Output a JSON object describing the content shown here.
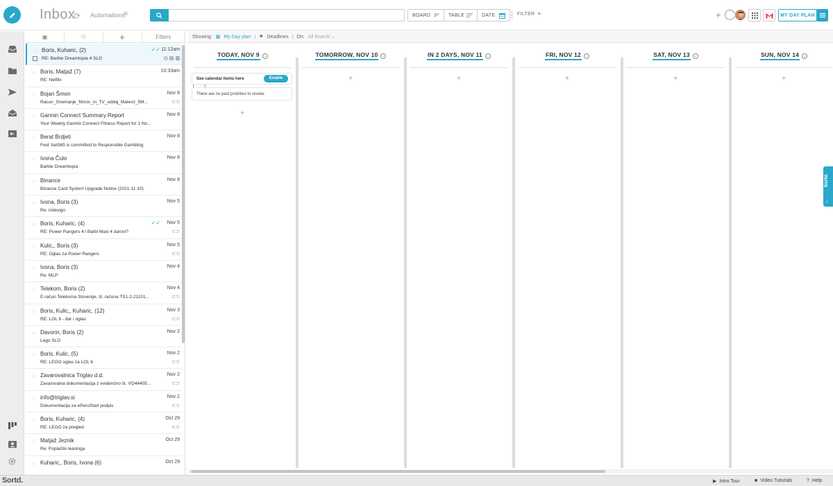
{
  "header": {
    "app_title": "Inbox",
    "automations_label": "Automations",
    "search_placeholder": "",
    "view_modes": [
      "BOARD",
      "TABLE",
      "DATE"
    ],
    "filter_label": "FILTER",
    "my_day_plan_label": "MY DAY PLAN"
  },
  "panel": {
    "tabs": [
      "",
      "",
      "",
      "Filters"
    ]
  },
  "emails": [
    {
      "sender": "Boris, Kuharic, (2)",
      "date": "11:12am",
      "subject": "RE: Barbie Dreamtopia 4 SLO",
      "selected": true,
      "replied": true
    },
    {
      "sender": "Boris, Matjaž (7)",
      "date": "10:33am",
      "subject": "RE: Netflix"
    },
    {
      "sender": "Bojan Šmon",
      "date": "Nov 8",
      "subject": "Racun_Snemanje_filmov_in_TV_oddaj_Matevz_5M...",
      "attach": true
    },
    {
      "sender": "Garmin Connect Summary Report",
      "date": "Nov 8",
      "subject": "Your Weekly Garmin Connect Fitness Report for 1 No..."
    },
    {
      "sender": "Berat Brdjeti",
      "date": "Nov 8",
      "subject": "Fwd: bet365 is committed to Responsible Gambling"
    },
    {
      "sender": "Ivona Čulo",
      "date": "Nov 8",
      "subject": "Barbie Dreamtopia"
    },
    {
      "sender": "Binance",
      "date": "Nov 8",
      "subject": "Binance Card System Upgrade Notice (2021-11-10)"
    },
    {
      "sender": "Ivona, Boris (3)",
      "date": "Nov 5",
      "subject": "Re: indesign"
    },
    {
      "sender": "Boris, Kuharic, (4)",
      "date": "Nov 5",
      "subject": "RE: Power Rangers 4 i Barbi Maxi 4 darovi?",
      "attach": true,
      "replied": true
    },
    {
      "sender": "Kulic,, Boris (3)",
      "date": "Nov 5",
      "subject": "RE: Oglas za Power Rangers",
      "attach": true
    },
    {
      "sender": "Ivona, Boris (3)",
      "date": "Nov 4",
      "subject": "Re: MLP"
    },
    {
      "sender": "Telekom, Boris (2)",
      "date": "Nov 4",
      "subject": "E-račun Telekoma Slovenije, št. računa TS1-2-21101...",
      "attach": true
    },
    {
      "sender": "Boris, Kulic,, Kuharic, (12)",
      "date": "Nov 3",
      "subject": "RE: LOL 6 - dar i oglas",
      "attach": true
    },
    {
      "sender": "Davorin, Boris (2)",
      "date": "Nov 2",
      "subject": "Lego SLO"
    },
    {
      "sender": "Boris, Kulic, (5)",
      "date": "Nov 2",
      "subject": "RE: LEGO oglas za LOL 6",
      "attach": true
    },
    {
      "sender": "Zavarovalnica Triglav d.d.",
      "date": "Nov 2",
      "subject": "Zavarovalna dokumentacija z evidenčno št. VO44405...",
      "attach": true
    },
    {
      "sender": "info@triglav.si",
      "date": "Nov 2",
      "subject": "Dokumentacija za ePeroStart podpis",
      "attach": true
    },
    {
      "sender": "Boris, Kuharic, (4)",
      "date": "Oct 29",
      "subject": "RE: LEGO za pregled",
      "attach": true
    },
    {
      "sender": "Matjaž Jeznik",
      "date": "Oct 29",
      "subject": "Re: Poplačilo leasinga"
    },
    {
      "sender": "Kuharic,, Boris, Ivona (6)",
      "date": "Oct 29",
      "subject": ""
    }
  ],
  "showing": {
    "label": "Showing:",
    "my_day_plan": "My Day plan",
    "deadlines": "Deadlines",
    "on_label": "On:",
    "all_boards": "All Boards"
  },
  "days": [
    "TODAY, NOV 9",
    "TOMORROW, NOV 10",
    "IN 2 DAYS, NOV 11",
    "FRI, NOV 12",
    "SAT, NOV 13",
    "SUN, NOV 14"
  ],
  "calendar_card": {
    "text": "See calendar items here",
    "enable_label": "Enable"
  },
  "past_card": {
    "text": "There are no past priorities to review."
  },
  "side_tab": {
    "label": "Sortd."
  },
  "footer": {
    "logo": "Sortd.",
    "intro_tour": "Intro Tour",
    "video_tutorials": "Video Tutorials",
    "help": "Help"
  },
  "colors": {
    "accent": "#2aa7c9",
    "separator": "#dcdcdc"
  },
  "icons": {
    "nav": [
      "inbox-icon",
      "folder-icon",
      "sent-icon",
      "open-mail-icon",
      "exit-icon"
    ],
    "nav_bottom": [
      "board-icon",
      "contact-icon",
      "gear-icon"
    ]
  }
}
